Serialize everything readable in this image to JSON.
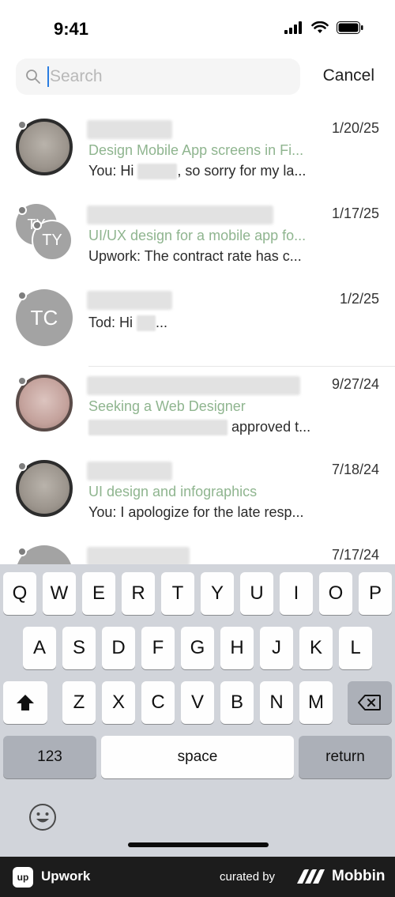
{
  "status_bar": {
    "time": "9:41"
  },
  "search": {
    "placeholder": "Search",
    "value": "",
    "cancel_label": "Cancel"
  },
  "conversations": [
    {
      "initials": "",
      "date": "1/20/25",
      "job": "Design Mobile App screens in Fi...",
      "message_prefix": "You: Hi",
      "message_suffix": ", so sorry for my la..."
    },
    {
      "initials": "TY",
      "date": "1/17/25",
      "job": "UI/UX design for a mobile app fo...",
      "message_prefix": "Upwork: The contract rate has c...",
      "message_suffix": ""
    },
    {
      "initials": "TC",
      "date": "1/2/25",
      "job": "",
      "message_prefix": "Tod: Hi",
      "message_suffix": "..."
    },
    {
      "initials": "",
      "date": "9/27/24",
      "job": "Seeking a Web Designer",
      "message_prefix": "",
      "message_suffix": "approved t..."
    },
    {
      "initials": "",
      "date": "7/18/24",
      "job": "UI design and infographics",
      "message_prefix": "You: I apologize for the late resp...",
      "message_suffix": ""
    },
    {
      "initials": "",
      "date": "7/17/24",
      "job": "",
      "message_prefix": "",
      "message_suffix": ""
    }
  ],
  "keyboard": {
    "row1": [
      "Q",
      "W",
      "E",
      "R",
      "T",
      "Y",
      "U",
      "I",
      "O",
      "P"
    ],
    "row2": [
      "A",
      "S",
      "D",
      "F",
      "G",
      "H",
      "J",
      "K",
      "L"
    ],
    "row3": [
      "Z",
      "X",
      "C",
      "V",
      "B",
      "N",
      "M"
    ],
    "numbers_label": "123",
    "space_label": "space",
    "return_label": "return",
    "shift_icon": "shift-icon",
    "delete_icon": "delete-icon",
    "emoji_icon": "emoji-icon"
  },
  "footer": {
    "app_name": "Upwork",
    "curated_by": "curated by",
    "brand": "Mobbin",
    "app_logo_text": "up"
  },
  "colors": {
    "accent_green": "#8fb58f",
    "keyboard_bg": "#d1d4da",
    "footer_bg": "#1c1c1c"
  }
}
